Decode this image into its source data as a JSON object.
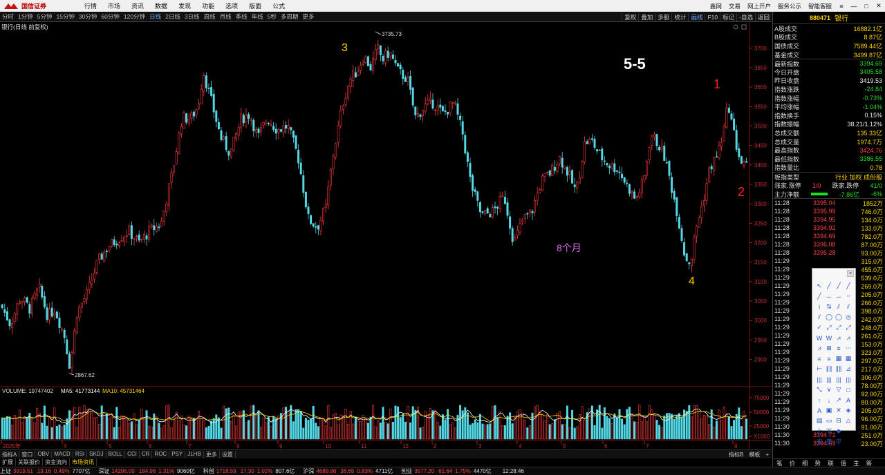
{
  "topbar": {
    "logo_text": "国信证券",
    "menu": [
      "行情",
      "市场",
      "资讯",
      "数据",
      "发现",
      "功能",
      "选项",
      "版面",
      "公式"
    ],
    "right_links": [
      "鑫网",
      "交易",
      "网上开户",
      "服务公示",
      "智能客服"
    ]
  },
  "periods": [
    "分时",
    "1分钟",
    "5分钟",
    "15分钟",
    "30分钟",
    "60分钟",
    "120分钟",
    "日线",
    "2日线",
    "3日线",
    "周线",
    "月线",
    "季线",
    "年线",
    "5秒",
    "多周期",
    "更多"
  ],
  "active_period": "日线",
  "period_right": [
    "复权",
    "叠加",
    "多股",
    "统计",
    "画线",
    "F10",
    "标记",
    "-自选",
    "返回"
  ],
  "chart": {
    "title": "银行(日线 前复权)",
    "max_label": "3735.73",
    "min_label": "2867.62",
    "y_ticks": [
      2900,
      2950,
      3000,
      3050,
      3100,
      3150,
      3200,
      3250,
      3300,
      3350,
      3400,
      3450,
      3500,
      3550,
      3600,
      3650,
      3700
    ],
    "annotations": {
      "wave_3": "3",
      "wave_4": "4",
      "wave_1": "1",
      "wave_2": "2",
      "label_55": "5-5",
      "months": "8个月"
    },
    "volume_header": {
      "label": "VOLUME: 19747402",
      "ma5": "MA5: 41773144",
      "ma10": "MA10: 45731464"
    },
    "volume_ticks": [
      "75000",
      "50000",
      "25000",
      "X1000"
    ],
    "x_labels": [
      "2025年",
      "4",
      "5",
      "6",
      "7",
      "8",
      "9",
      "10",
      "11",
      "12",
      "2",
      "3",
      "4",
      "5",
      "6",
      "7",
      "8"
    ],
    "colors": {
      "up": "#ff3b3b",
      "down": "#54d8e6",
      "ma5": "#ffffff",
      "ma10": "#ffd700"
    }
  },
  "indicators": [
    "指标A",
    "窗口",
    "OBV",
    "MACD",
    "RSI",
    "SKDJ",
    "BOLL",
    "CCI",
    "CR",
    "ROC",
    "PSY",
    "JLHB",
    "更多",
    "设置"
  ],
  "indicator_right": [
    "指标B",
    "模板",
    "+"
  ],
  "subtabs": [
    "扩展",
    "关联报价",
    "资金流向",
    "市场资讯"
  ],
  "right_panel": {
    "code": "880471",
    "name": "银行",
    "rows": [
      {
        "label": "A股成交",
        "value": "16882.1亿",
        "color": "yellow"
      },
      {
        "label": "B股成交",
        "value": "8.87亿",
        "color": "yellow"
      },
      {
        "label": "国债成交",
        "value": "7589.44亿",
        "color": "yellow"
      },
      {
        "label": "基金成交",
        "value": "3499.87亿",
        "color": "yellow"
      },
      {
        "label": "最新指数",
        "value": "3394.69",
        "color": "green"
      },
      {
        "label": "今日开盘",
        "value": "3405.58",
        "color": "green"
      },
      {
        "label": "昨日收盘",
        "value": "3419.53",
        "color": "white"
      },
      {
        "label": "指数涨跌",
        "value": "-24.84",
        "color": "green"
      },
      {
        "label": "指数涨幅",
        "value": "-0.73%",
        "color": "green"
      },
      {
        "label": "平均涨幅",
        "value": "-1.04%",
        "color": "green"
      },
      {
        "label": "指数换手",
        "value": "0.15%",
        "color": "white"
      },
      {
        "label": "指数振幅",
        "value": "38.21/1.12%",
        "color": "white"
      },
      {
        "label": "总成交额",
        "value": "135.33亿",
        "color": "yellow"
      },
      {
        "label": "总成交量",
        "value": "1974.7万",
        "color": "yellow"
      },
      {
        "label": "最高指数",
        "value": "3424.76",
        "color": "red"
      },
      {
        "label": "最低指数",
        "value": "3386.55",
        "color": "green"
      },
      {
        "label": "指数量比",
        "value": "0.78",
        "color": "yellow"
      }
    ],
    "type_label": "板指类型",
    "type_links": "行业 加权 成份股",
    "updown_label": "涨家.涨停",
    "updown_value": "1/0",
    "down_label": "跌家.跌停",
    "down_value": "41/0",
    "flow_label": "主力净额",
    "flow_value": "-7.86亿",
    "flow_pct": "-6%",
    "ticks": [
      {
        "t": "11:28",
        "p": "3395.04",
        "v": "1852万"
      },
      {
        "t": "11:28",
        "p": "3395.99",
        "v": "746.0万"
      },
      {
        "t": "11:28",
        "p": "3394.95",
        "v": "134.0万"
      },
      {
        "t": "11:28",
        "p": "3394.92",
        "v": "133.0万"
      },
      {
        "t": "11:28",
        "p": "3394.69",
        "v": "782.0万"
      },
      {
        "t": "11:28",
        "p": "3396.08",
        "v": "87.00万"
      },
      {
        "t": "11:28",
        "p": "3395.28",
        "v": "93.00万"
      },
      {
        "t": "11:29",
        "p": "",
        "v": "315.0万"
      },
      {
        "t": "11:29",
        "p": "",
        "v": "455.0万"
      },
      {
        "t": "11:29",
        "p": "",
        "v": "539.0万"
      },
      {
        "t": "11:29",
        "p": "",
        "v": "269.0万"
      },
      {
        "t": "11:29",
        "p": "",
        "v": "205.0万"
      },
      {
        "t": "11:29",
        "p": "",
        "v": "266.0万"
      },
      {
        "t": "11:29",
        "p": "",
        "v": "398.0万"
      },
      {
        "t": "11:29",
        "p": "",
        "v": "242.0万"
      },
      {
        "t": "11:29",
        "p": "",
        "v": "248.0万"
      },
      {
        "t": "11:29",
        "p": "",
        "v": "261.0万"
      },
      {
        "t": "11:29",
        "p": "",
        "v": "153.0万"
      },
      {
        "t": "11:29",
        "p": "",
        "v": "323.0万"
      },
      {
        "t": "11:29",
        "p": "",
        "v": "297.0万"
      },
      {
        "t": "11:29",
        "p": "",
        "v": "217.0万"
      },
      {
        "t": "11:29",
        "p": "",
        "v": "306.0万"
      },
      {
        "t": "11:29",
        "p": "",
        "v": "78.00万"
      },
      {
        "t": "11:29",
        "p": "",
        "v": "92.00万"
      },
      {
        "t": "11:29",
        "p": "",
        "v": "80.00万"
      },
      {
        "t": "11:29",
        "p": "",
        "v": "205.0万"
      },
      {
        "t": "11:29",
        "p": "",
        "v": "96.00万"
      },
      {
        "t": "11:30",
        "p": "3394.82",
        "v": "91.00万"
      },
      {
        "t": "11:30",
        "p": "3394.71",
        "v": "251.0万"
      },
      {
        "t": "11:30",
        "p": "3394.69",
        "v": "23.00万"
      }
    ],
    "tabs": [
      "笔",
      "价",
      "细",
      "势",
      "联",
      "值",
      "主",
      "筹"
    ]
  },
  "drawtools": {
    "close": "×",
    "icons": [
      "↖",
      "╱",
      "╱",
      "╱",
      "╱",
      "─",
      "─",
      "┄",
      "ǀ",
      "⇅",
      "⫽",
      "⫽",
      "⫽",
      "◯",
      "◯",
      "◎",
      "✓",
      "⤢",
      "⤢",
      "⤢",
      "W",
      "W",
      "⩘",
      "⩘",
      "⩘",
      "⊞",
      "≡",
      "⋯",
      "≡",
      "≡",
      "▦",
      "▦",
      "⊢",
      "∥∥",
      "∥∥",
      "⊿",
      "|||",
      "|||",
      "|||",
      "|||",
      "⤡",
      "∨",
      "▽",
      "□",
      "↑",
      "↓",
      "↗",
      "A",
      "A",
      "▣",
      "✕",
      "◈",
      "▤",
      "▭",
      "⊟",
      "△",
      "上",
      "下",
      "◆",
      "",
      "买",
      "卖",
      "平",
      ""
    ]
  },
  "statusbar": [
    {
      "name": "上证",
      "val": "3919.51",
      "chg": "19.16",
      "pct": "0.49%",
      "amt": "7707亿"
    },
    {
      "name": "深证",
      "val": "14295.00",
      "chg": "184.96",
      "pct": "1.31%",
      "amt": "9060亿"
    },
    {
      "name": "科创",
      "val": "1718.59",
      "chg": "17.30",
      "pct": "1.02%",
      "amt": "807.6亿"
    },
    {
      "name": "沪深",
      "val": "4689.96",
      "chg": "38.65",
      "pct": "0.83%",
      "amt": "4711亿"
    },
    {
      "name": "创业",
      "val": "3577.20",
      "chg": "61.64",
      "pct": "1.75%",
      "amt": "4470亿"
    }
  ],
  "clock": "12:28:46"
}
